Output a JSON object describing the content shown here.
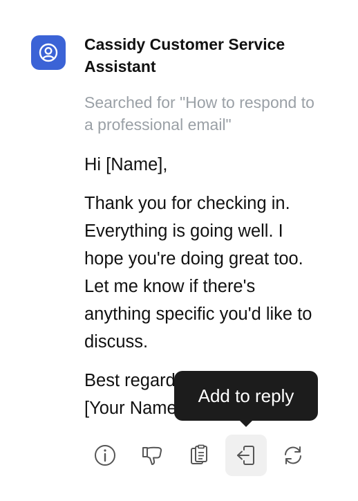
{
  "assistant": {
    "name": "Cassidy Customer Service Assistant",
    "avatar_icon": "user-circle-icon",
    "avatar_color": "#3b63d6"
  },
  "search_status": "Searched for \"How to respond to a professional email\"",
  "message": {
    "greeting": "Hi [Name],",
    "body": "Thank you for checking in. Everything is going well. I hope you're doing great too. Let me know if there's anything specific you'd like to discuss.",
    "closing_line1": "Best regards,",
    "closing_line2": "[Your Name]"
  },
  "tooltip": {
    "text": "Add to reply"
  },
  "actions": [
    {
      "name": "info",
      "icon": "info-icon"
    },
    {
      "name": "dislike",
      "icon": "thumbs-down-icon"
    },
    {
      "name": "copy",
      "icon": "clipboard-icon"
    },
    {
      "name": "add-to-reply",
      "icon": "add-to-reply-icon",
      "hovered": true
    },
    {
      "name": "regenerate",
      "icon": "refresh-icon"
    }
  ],
  "colors": {
    "muted_text": "#9aa0a6",
    "tooltip_bg": "#1c1c1c",
    "hover_bg": "#f0f0f0",
    "icon": "#555555"
  }
}
